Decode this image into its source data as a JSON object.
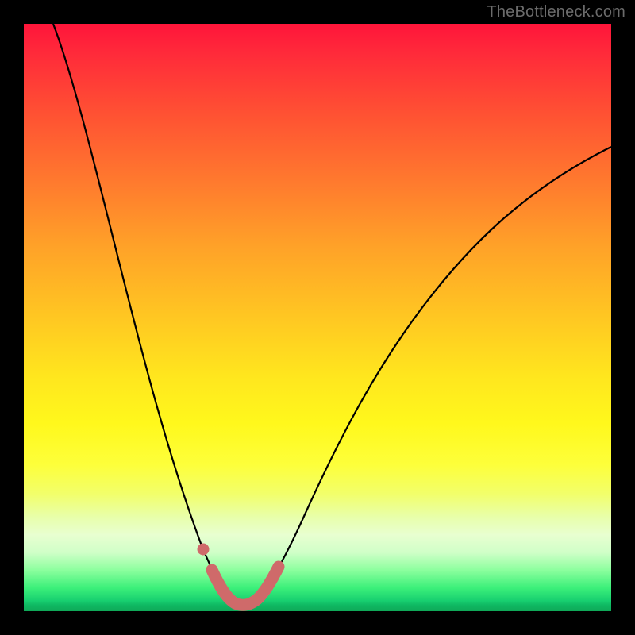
{
  "watermark": {
    "text": "TheBottleneck.com"
  },
  "colors": {
    "frame": "#000000",
    "curve": "#000000",
    "highlight": "#cf6a6a"
  },
  "chart_data": {
    "type": "line",
    "title": "",
    "xlabel": "",
    "ylabel": "",
    "xlim": [
      0,
      100
    ],
    "ylim": [
      0,
      100
    ],
    "grid": false,
    "legend": false,
    "_comment": "Curve represents bottleneck % (y) across a swept parameter (x). Values estimated from pixels; minimum ~33–38% sweep at ~0 bottleneck. y=100 is top (worst), y=0 is bottom (optimal).",
    "series": [
      {
        "name": "bottleneck-curve",
        "x": [
          5,
          8,
          11,
          14,
          17,
          20,
          23,
          26,
          29,
          31,
          33,
          35,
          37,
          39,
          42,
          46,
          51,
          57,
          64,
          72,
          80,
          88,
          96,
          100
        ],
        "values": [
          100,
          94,
          87,
          79,
          71,
          62,
          52,
          41,
          29,
          17,
          8,
          2,
          0,
          2,
          9,
          20,
          33,
          45,
          55,
          63,
          69,
          73.5,
          77,
          78.5
        ]
      }
    ],
    "highlight_range": {
      "x_start": 31,
      "x_end": 41,
      "_comment": "Thick salmon segment near the minimum plus one isolated dot just before it."
    }
  }
}
